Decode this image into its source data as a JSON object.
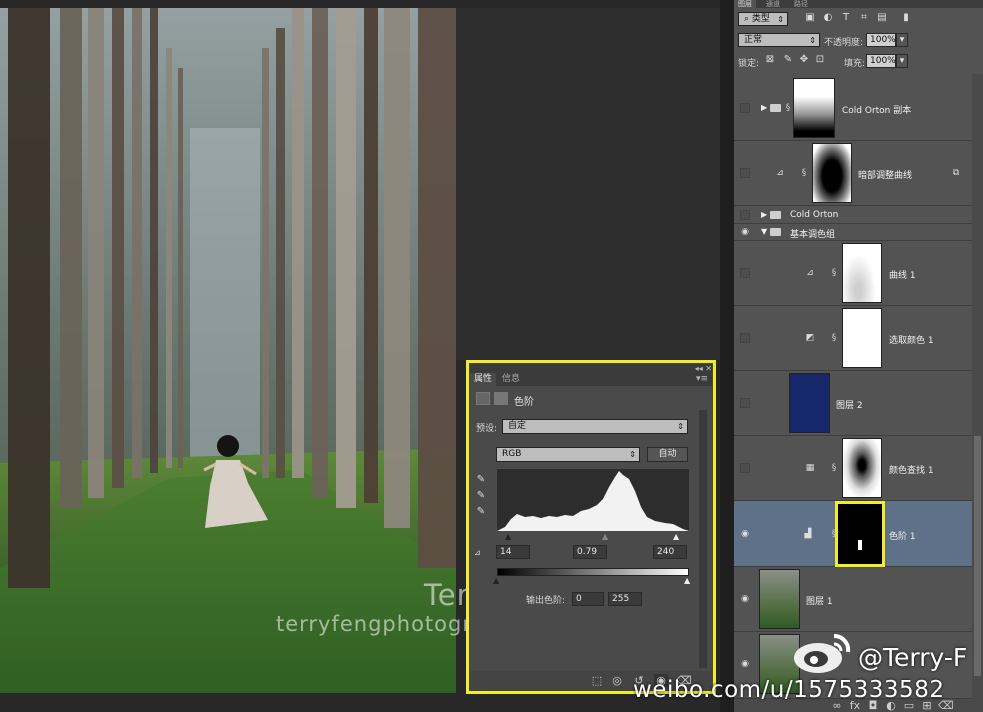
{
  "watermark": {
    "name": "Terry F",
    "url": "terryfengphotography.lofter.com"
  },
  "weibo": {
    "handle": "@Terry-F",
    "url": "weibo.com/u/1575333582"
  },
  "properties_panel": {
    "tabs": [
      "属性",
      "信息"
    ],
    "collapse_glyph": "◂◂ ✕",
    "menu_glyph": "▾≡",
    "title": "色阶",
    "preset_label": "预设:",
    "preset_value": "自定",
    "channel_value": "RGB",
    "auto_button": "自动",
    "input_black": "14",
    "input_gamma": "0.79",
    "input_white": "240",
    "output_label": "输出色阶:",
    "output_black": "0",
    "output_white": "255",
    "highlight_color": "#f3ec2c"
  },
  "layers_panel": {
    "tabs": [
      "图层",
      "通道",
      "路径"
    ],
    "filter_kind": "类型",
    "blend_mode": "正常",
    "opacity_label": "不透明度:",
    "opacity_value": "100%",
    "lock_label": "锁定:",
    "fill_label": "填充:",
    "fill_value": "100%",
    "layers": [
      {
        "name": "Cold Orton 副本",
        "type": "group",
        "visible": false
      },
      {
        "name": "暗部调整曲线",
        "type": "curves",
        "visible": false
      },
      {
        "name": "Cold Orton",
        "type": "group",
        "visible": false
      },
      {
        "name": "基本调色组",
        "type": "group",
        "visible": true
      },
      {
        "name": "曲线 1",
        "type": "curves",
        "visible": false
      },
      {
        "name": "选取颜色 1",
        "type": "selective-color",
        "visible": false
      },
      {
        "name": "图层 2",
        "type": "fill",
        "visible": false,
        "color": "#16286b"
      },
      {
        "name": "颜色查找 1",
        "type": "color-lookup",
        "visible": false
      },
      {
        "name": "色阶 1",
        "type": "levels",
        "visible": true,
        "selected": true
      },
      {
        "name": "图层 1",
        "type": "pixel",
        "visible": true
      },
      {
        "name": "",
        "type": "pixel",
        "visible": true
      }
    ]
  },
  "icons": {
    "eye": "eye-icon",
    "chain": "chain-link-icon",
    "folder": "folder-icon",
    "eyedropper": "eyedropper-icon"
  }
}
